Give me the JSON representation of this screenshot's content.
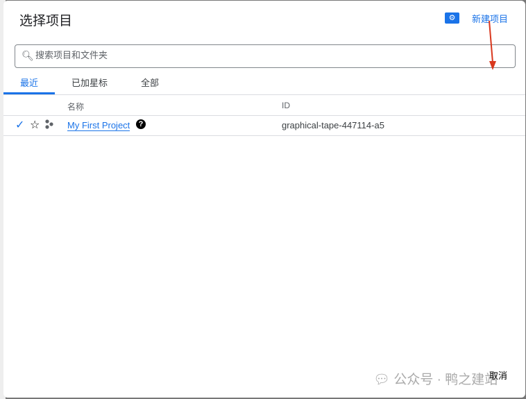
{
  "dialog": {
    "title": "选择项目",
    "new_project": "新建项目",
    "search_placeholder": "搜索项目和文件夹",
    "tabs": [
      {
        "label": "最近"
      },
      {
        "label": "已加星标"
      },
      {
        "label": "全部"
      }
    ],
    "columns": {
      "name": "名称",
      "id": "ID"
    },
    "rows": [
      {
        "name": "My First Project",
        "id": "graphical-tape-447114-a5"
      }
    ],
    "cancel": "取消"
  },
  "watermark": "公众号 · 鸭之建站",
  "colors": {
    "accent": "#1a73e8",
    "arrow": "#d9381e"
  }
}
